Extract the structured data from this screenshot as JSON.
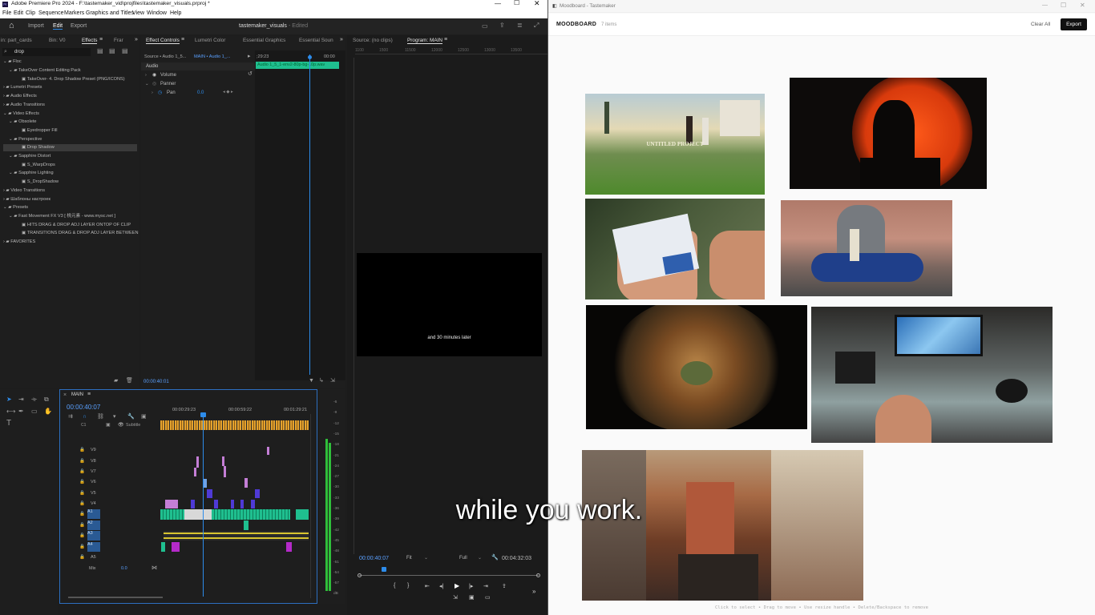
{
  "premiere": {
    "title": "Adobe Premiere Pro 2024 - F:\\tastemaker_vid\\projfiles\\tastemaker_visuals.prproj *",
    "menu": [
      "File",
      "Edit",
      "Clip",
      "Sequence",
      "Markers",
      "Graphics and Titles",
      "View",
      "Window",
      "Help"
    ],
    "workspace": {
      "import": "Import",
      "edit": "Edit",
      "export": "Export",
      "project": "tastemaker_visuals",
      "edited": "- Edited"
    },
    "effects_panel": {
      "tabs": [
        "in: part_cards",
        "Bin: V0",
        "Effects",
        "Frar"
      ],
      "search": "drop",
      "tree": [
        {
          "label": "Floc",
          "depth": 0
        },
        {
          "label": "TakeOver Content Editing Pack",
          "depth": 1
        },
        {
          "label": "TakeOver- 4. Drop Shadow Preset (PNG/ICONS)",
          "depth": 2
        },
        {
          "label": "Lumetri Presets",
          "depth": 0
        },
        {
          "label": "Audio Effects",
          "depth": 0
        },
        {
          "label": "Audio Transitions",
          "depth": 0
        },
        {
          "label": "Video Effects",
          "depth": 0
        },
        {
          "label": "Obsolete",
          "depth": 1
        },
        {
          "label": "Eyedropper Fill",
          "depth": 2
        },
        {
          "label": "Perspective",
          "depth": 1
        },
        {
          "label": "Drop Shadow",
          "depth": 2
        },
        {
          "label": "Sapphire Distort",
          "depth": 1
        },
        {
          "label": "S_WarpDrops",
          "depth": 2
        },
        {
          "label": "Sapphire Lighting",
          "depth": 1
        },
        {
          "label": "S_DropShadow",
          "depth": 2
        },
        {
          "label": "Video Transitions",
          "depth": 0
        },
        {
          "label": "Шаблоны настроек",
          "depth": 0
        },
        {
          "label": "Presets",
          "depth": 0
        },
        {
          "label": "Fast Movement FX V3 [ 桃元素 - www.mysc.net ]",
          "depth": 1
        },
        {
          "label": "HITS DRAG & DROP ADJ LAYER ONTOP OF CLIP",
          "depth": 2
        },
        {
          "label": "TRANSITIONS DRAG & DROP ADJ LAYER BETWEEN",
          "depth": 2
        },
        {
          "label": "FAVORITES",
          "depth": 0
        }
      ]
    },
    "effect_controls": {
      "tabs": [
        "Effect Controls",
        "Lumetri Color",
        "Essential Graphics",
        "Essential Soun"
      ],
      "source": "Source • Audio 1_5...",
      "seq": "MAIN • Audio 1_...",
      "time": ";29:23",
      "time2": "00:00",
      "clip": "Audio 1_5_1-env2-80p-bg-10p.wav",
      "audio": "Audio",
      "volume": "Volume",
      "panner": "Panner",
      "pan": "Pan",
      "pan_val": "0.0",
      "timecode": "00:00:40:01"
    },
    "program": {
      "source_tab": "Source: (no clips)",
      "program_tab": "Program: MAIN",
      "ruler": [
        "1100",
        "1500",
        "11500",
        "12000",
        "12500",
        "13000",
        "13500"
      ],
      "caption": "and 30 minutes later",
      "tc": "00:00:40:07",
      "fit": "Fit",
      "full": "Full",
      "dur": "00:04:32:03"
    },
    "timeline": {
      "seq": "MAIN",
      "tc": "00:00:40:07",
      "ruler": [
        "00:00:29:23",
        "00:00:59:22",
        "00:01:29:21"
      ],
      "subtitle": "Subtitle",
      "c1": "C1",
      "video_tracks": [
        "V9",
        "V8",
        "V7",
        "V6",
        "V5",
        "V4"
      ],
      "audio_tracks": [
        "A1",
        "A2",
        "A3",
        "A4",
        "A5"
      ],
      "mix": "Mix",
      "mix_val": "0.0",
      "meter": [
        "-6",
        "-9",
        "-12",
        "-15",
        "-18",
        "-21",
        "-24",
        "-27",
        "-30",
        "-33",
        "-36",
        "-39",
        "-42",
        "-45",
        "-48",
        "-51",
        "-54",
        "-57",
        "dB"
      ]
    }
  },
  "moodboard": {
    "window_title": "Moodboard - Tastemaker",
    "title": "MOODBOARD",
    "count": "7 items",
    "clear": "Clear All",
    "export": "Export",
    "image1_text": "UNTITLED PROJECT",
    "footer": "Click to select • Drag to move • Use resize handle • Delete/Backspace to remove"
  },
  "subtitle_overlay": "while you work.",
  "colors": {
    "accent": "#2d8ceb",
    "audio_green": "#1fbf8f",
    "pink": "#c47ed6",
    "purple": "#6a4fe0",
    "yellow": "#d9c530"
  }
}
